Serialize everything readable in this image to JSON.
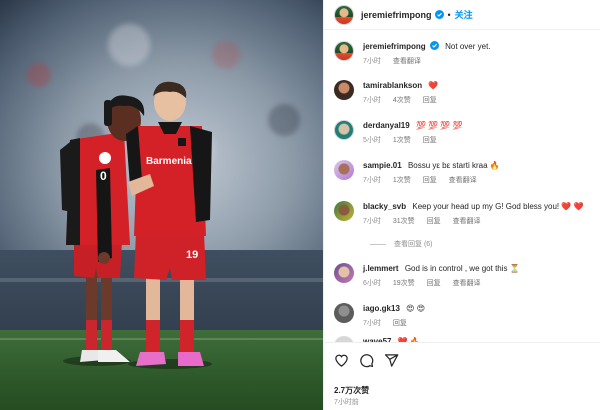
{
  "post": {
    "username": "jeremiefrimpong",
    "follow_label": "关注",
    "dot": "•",
    "likes": "2.7万次赞",
    "time": "7小时前"
  },
  "photo": {
    "jersey_sponsor": "Barmenia",
    "description_icons": [
      "player-left",
      "player-right"
    ]
  },
  "comments": [
    {
      "user": "jeremiefrimpong",
      "text": "Not over yet.",
      "time": "7小时",
      "likes": "",
      "reply": "",
      "translate": "查看翻译"
    },
    {
      "user": "tamirablankson",
      "text": "❤️",
      "time": "7小时",
      "likes": "4次赞",
      "reply": "回复",
      "translate": ""
    },
    {
      "user": "derdanyal19",
      "text": "💯 💯 💯 💯",
      "time": "5小时",
      "likes": "1次赞",
      "reply": "回复",
      "translate": ""
    },
    {
      "user": "sampie.01",
      "text": "Bossu yε bε starti kraa 🔥",
      "time": "7小时",
      "likes": "1次赞",
      "reply": "回复",
      "translate": "查看翻译"
    },
    {
      "user": "blacky_svb",
      "text": "Keep your head up my G! God bless you! ❤️ ❤️",
      "time": "7小时",
      "likes": "31次赞",
      "reply": "回复",
      "translate": "查看翻译"
    },
    {
      "user": "j.lemmert",
      "text": "God is in control , we got this ⏳",
      "time": "6小时",
      "likes": "19次赞",
      "reply": "回复",
      "translate": "查看翻译"
    },
    {
      "user": "iago.gk13",
      "text": "😍 😍",
      "time": "7小时",
      "likes": "",
      "reply": "回复",
      "translate": ""
    },
    {
      "user": "wave57",
      "text": "❤️ 🔥",
      "time": "",
      "likes": "",
      "reply": "",
      "translate": ""
    }
  ],
  "replies_toggle": "查看回复 (6)",
  "colors": {
    "accent": "#0095f6",
    "heart": "#e0245e",
    "jersey_red": "#d42127",
    "jersey_black": "#151515"
  }
}
